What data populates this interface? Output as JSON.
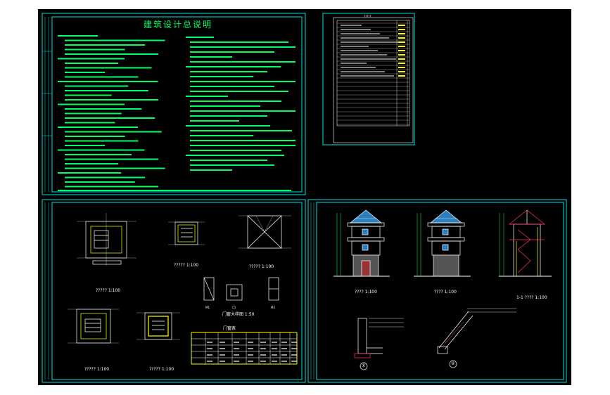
{
  "drawing": {
    "title": "建筑设计总说明",
    "index_heading": "?????"
  },
  "captions": {
    "plan_1": "????? 1:100",
    "plan_2": "????? 1:100",
    "plan_3": "????? 1:100",
    "plan_4": "????? 1:100",
    "plan_5": "????? 1:100",
    "elev_1": "???? 1:100",
    "elev_2": "???? 1:100",
    "section": "1-1 ???? 1:100",
    "details_heading": "门窗大样图 1:50",
    "door_table_heading": "门窗表",
    "door_labels": [
      "M1",
      "C1",
      "M2"
    ],
    "node_1": "①",
    "node_2": "②"
  },
  "colors": {
    "background": "#000000",
    "frame": "#00e0e0",
    "notes_text": "#00ff66",
    "lines": "#ffffff",
    "accent": "#ffff00",
    "hatch": "#ff3366"
  }
}
